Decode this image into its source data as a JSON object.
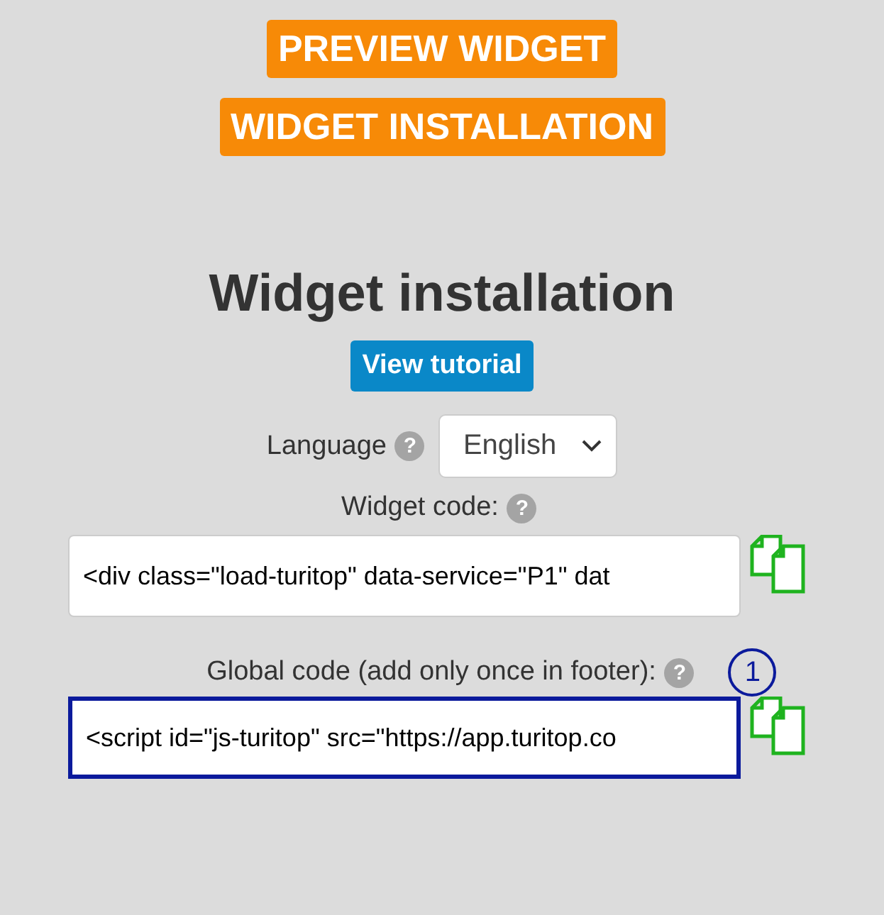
{
  "header_buttons": [
    "PREVIEW WIDGET",
    "WIDGET INSTALLATION"
  ],
  "title": "Widget installation",
  "tutorial_button": "View tutorial",
  "language": {
    "label": "Language",
    "help": "?",
    "value": "English"
  },
  "code_fields": [
    {
      "label": "Widget code:",
      "help": "?",
      "value": "<div class=\"load-turitop\" data-service=\"P1\" dat",
      "highlighted": false
    },
    {
      "label": "Global code (add only once in footer):",
      "help": "?",
      "value": "<script id=\"js-turitop\" src=\"https://app.turitop.co",
      "highlighted": true,
      "step": "1"
    }
  ]
}
